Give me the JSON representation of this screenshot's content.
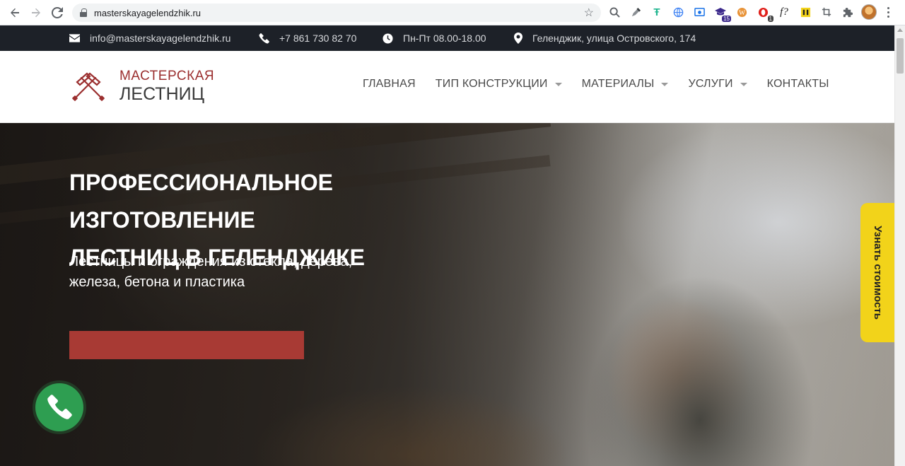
{
  "browser": {
    "url": "masterskayagelendzhik.ru",
    "extensions": [
      "search-icon",
      "eyedropper-icon",
      "t-extension-icon",
      "globe-icon",
      "screen-capture-icon",
      "graduation-cap-icon",
      "wordpress-icon",
      "opera-icon",
      "f-extension-icon",
      "yellow-extension-icon",
      "crop-icon",
      "puzzle-icon",
      "avatar"
    ],
    "badges": {
      "graduation_cap": "15",
      "opera": "1"
    }
  },
  "infobar": {
    "email": "info@masterskayagelendzhik.ru",
    "phone": "+7 861 730 82 70",
    "hours": "Пн-Пт 08.00-18.00",
    "address": "Геленджик, улица Островского, 174"
  },
  "logo": {
    "line1": "МАСТЕРСКАЯ",
    "line2": "ЛЕСТНИЦ"
  },
  "nav": {
    "items": [
      {
        "label": "ГЛАВНАЯ",
        "dropdown": false
      },
      {
        "label": "ТИП КОНСТРУКЦИИ",
        "dropdown": true
      },
      {
        "label": "МАТЕРИАЛЫ",
        "dropdown": true
      },
      {
        "label": "УСЛУГИ",
        "dropdown": true
      },
      {
        "label": "КОНТАКТЫ",
        "dropdown": false
      }
    ]
  },
  "hero": {
    "title_line1": "ПРОФЕССИОНАЛЬНОЕ ИЗГОТОВЛЕНИЕ",
    "title_line2": "ЛЕСТНИЦ В ГЕЛЕНДЖИКЕ",
    "subtitle_line1": "Лестницы и ограждения из стекла, дерева,",
    "subtitle_line2": "железа, бетона и пластика"
  },
  "side_tab": {
    "label": "Узнать стоимость"
  },
  "colors": {
    "infobar_bg": "#1d2128",
    "brand_red": "#9b2f2f",
    "cta_red": "#a83a34",
    "side_tab_yellow": "#f2d31a",
    "call_green": "#2e9e51"
  }
}
